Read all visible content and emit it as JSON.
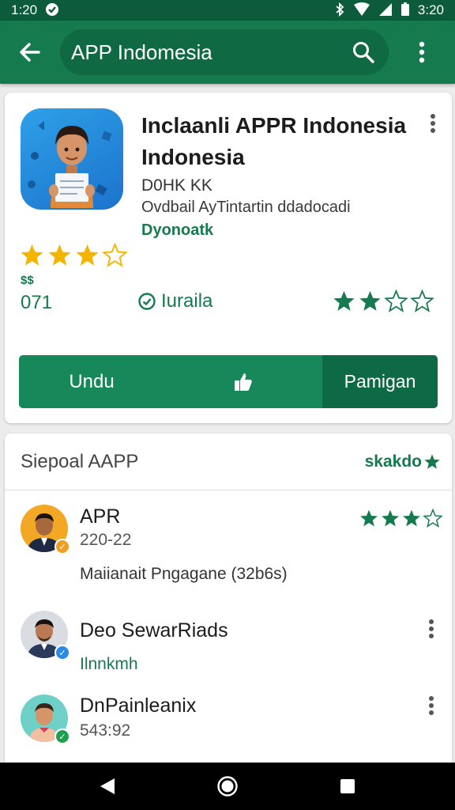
{
  "status_bar": {
    "time_left": "1:20",
    "time_right": "3:20",
    "icons": [
      "notification-icon",
      "bluetooth-icon",
      "wifi-icon",
      "signal-icon",
      "battery-icon"
    ]
  },
  "search": {
    "query": "APP Indomesia",
    "icons": [
      "back-arrow-icon",
      "search-icon",
      "more-vert-icon"
    ]
  },
  "app": {
    "title": "Inclaanli APPR Indonesia Indonesia",
    "developer": "D0HK KK",
    "description": "Ovdbail AyTintartin ddadocadi",
    "tag": "Dyonoatk",
    "rating_stars": 3.5,
    "price_label": "$$",
    "count": "071",
    "status_label": "Iuraila",
    "secondary_rating_stars": 2,
    "download_label": "Undu",
    "open_label": "Pamigan"
  },
  "reviews": {
    "section_title": "Siepoal AAPP",
    "see_all_label": "skakdo",
    "items": [
      {
        "name": "APR",
        "date": "220-22",
        "body": "Maiianait Pngagane (32b6s)",
        "stars": 3.5,
        "badge_color": "#f0a020"
      },
      {
        "name": "Deo SewarRiads",
        "sub": "Ilnnkmh",
        "badge_color": "#2a8ae8"
      },
      {
        "name": "DnPainleanix",
        "date": "543:92",
        "badge_color": "#1ea050"
      }
    ]
  },
  "colors": {
    "primary": "#157a4e",
    "primary_dark": "#0c5b3a",
    "star": "#f5b400",
    "review_star": "#157a4e"
  },
  "nav": {
    "icons": [
      "back-triangle-icon",
      "home-circle-icon",
      "recents-square-icon"
    ]
  }
}
